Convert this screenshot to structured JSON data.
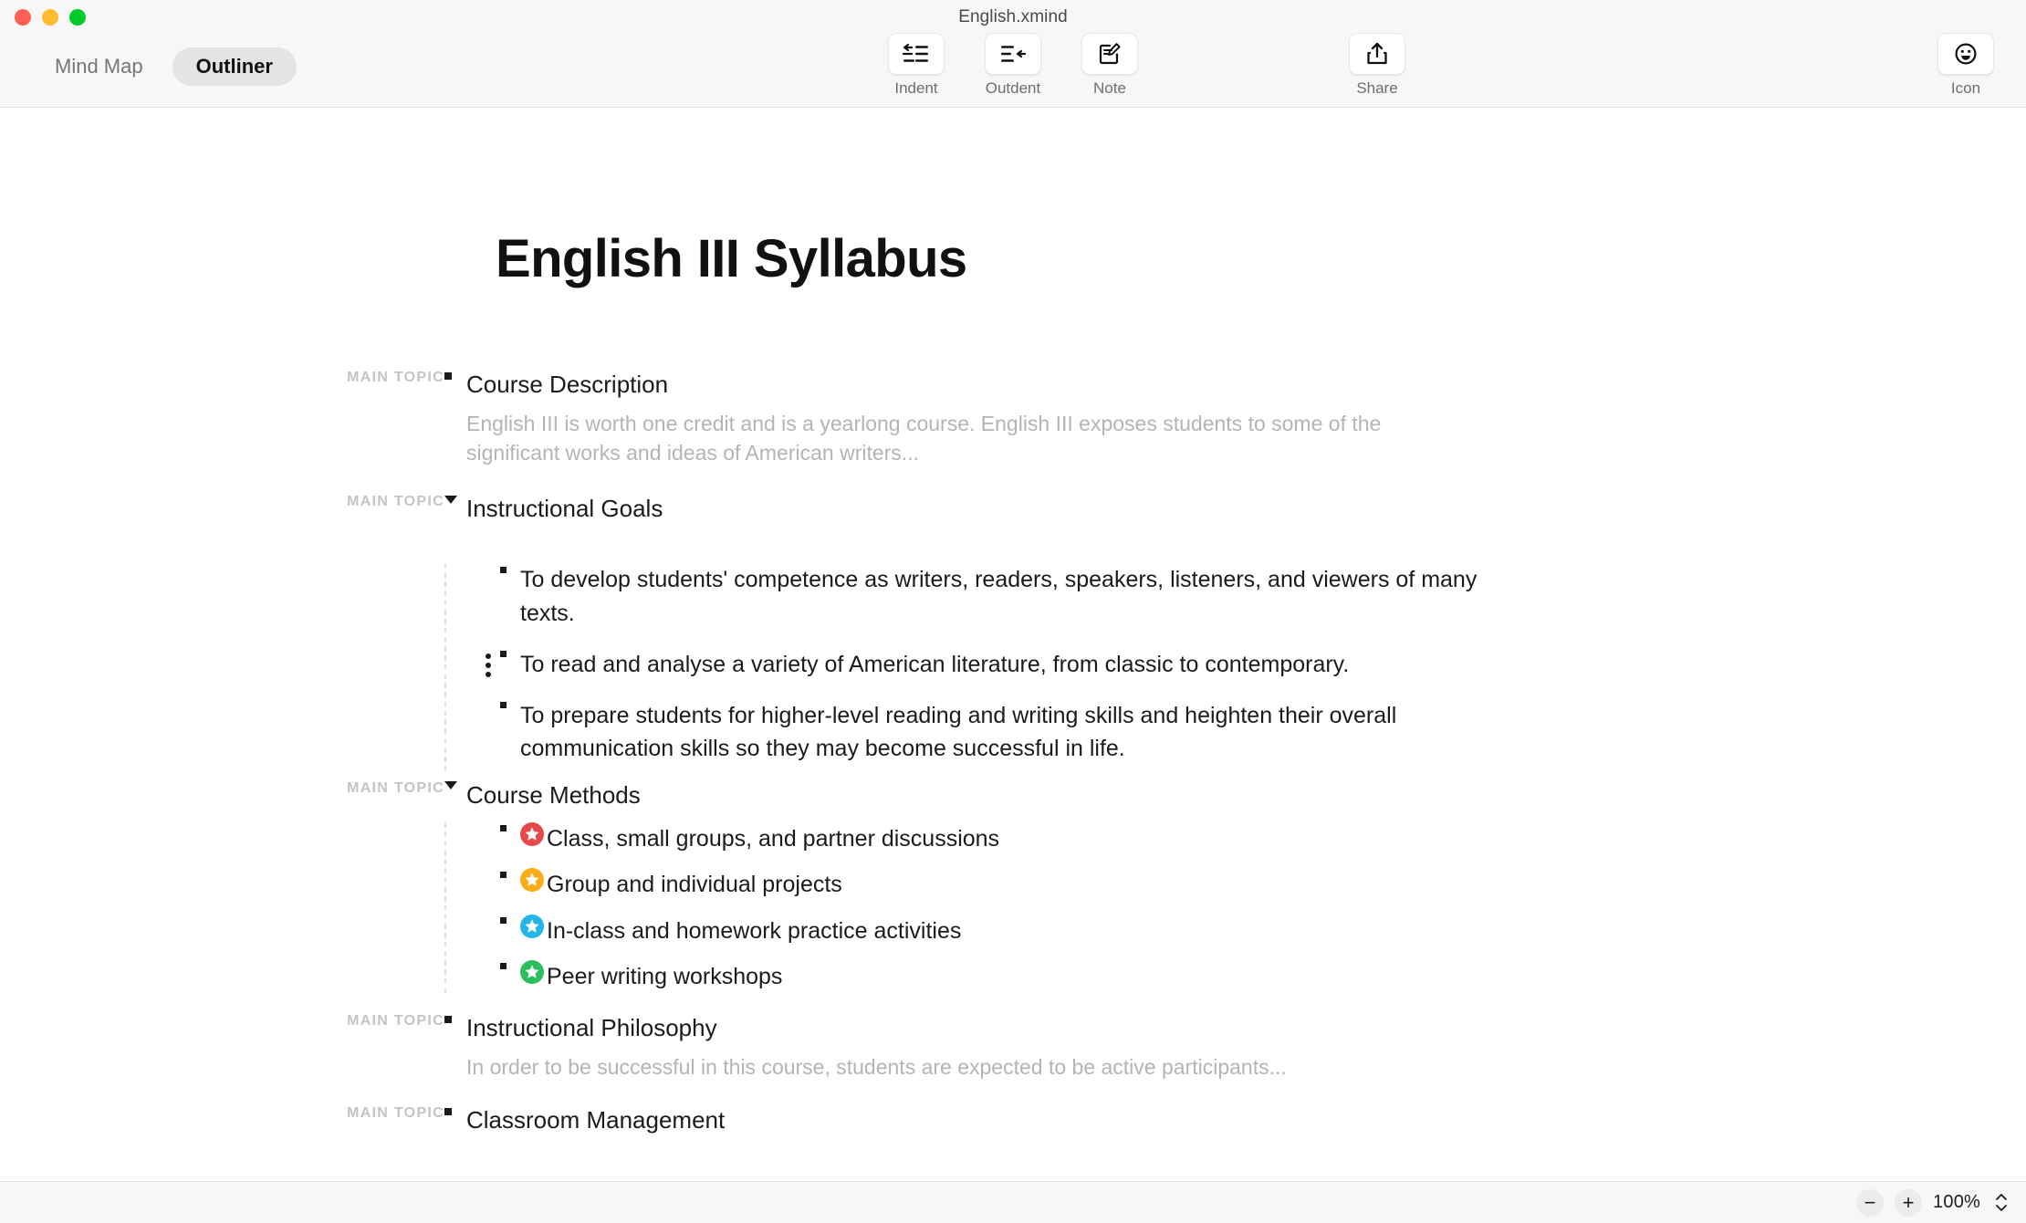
{
  "window": {
    "document_title": "English.xmind",
    "traffic_lights": [
      "close",
      "minimize",
      "maximize"
    ]
  },
  "view_switch": {
    "options": [
      "Mind Map",
      "Outliner"
    ],
    "selected": "Outliner"
  },
  "toolbar": {
    "center": [
      {
        "label": "Indent",
        "icon": "indent-icon"
      },
      {
        "label": "Outdent",
        "icon": "outdent-icon"
      },
      {
        "label": "Note",
        "icon": "note-icon"
      }
    ],
    "share": {
      "label": "Share",
      "icon": "share-icon"
    },
    "icon_tool": {
      "label": "Icon",
      "icon": "smiley-icon"
    }
  },
  "outline": {
    "heading": "English III Syllabus",
    "gutter_label": "MAIN TOPIC",
    "topics": [
      {
        "title": "Course Description",
        "marker": "square",
        "note": "English III is worth one credit and is a yearlong course. English III exposes students to some of the significant works and ideas of American writers...",
        "children": []
      },
      {
        "title": "Instructional Goals",
        "marker": "triangle",
        "children": [
          {
            "text": "To develop students' competence as writers, readers, speakers, listeners, and viewers of many texts."
          },
          {
            "text": "To read and analyse a variety of American literature, from classic to contemporary.",
            "drag_handle": true
          },
          {
            "text": "To prepare students for higher-level reading and writing skills and heighten their overall communication skills so they may become successful in life."
          }
        ]
      },
      {
        "title": "Course Methods",
        "marker": "triangle",
        "children": [
          {
            "text": "Class, small groups, and partner discussions",
            "icon": "star-icon",
            "icon_color": "#e8484a"
          },
          {
            "text": "Group and individual projects",
            "icon": "star-icon",
            "icon_color": "#fbad17"
          },
          {
            "text": "In-class and homework practice activities",
            "icon": "star-icon",
            "icon_color": "#22b5e8"
          },
          {
            "text": "Peer writing workshops",
            "icon": "star-icon",
            "icon_color": "#2bbe5e"
          }
        ]
      },
      {
        "title": "Instructional Philosophy",
        "marker": "square",
        "note": "In order to be successful in this course, students are expected to be active participants...",
        "children": []
      },
      {
        "title": "Classroom Management",
        "marker": "square",
        "children": []
      }
    ]
  },
  "statusbar": {
    "zoom_out_label": "−",
    "zoom_in_label": "+",
    "zoom_value": "100%"
  },
  "colors": {
    "chrome_bg": "#f7f7f7",
    "canvas_bg": "#ffffff",
    "gutter_text": "#c4c4c7",
    "note_text": "#b4b4b6",
    "topic_text": "#1b1b1b",
    "segment_active_bg": "#e4e4e6"
  }
}
